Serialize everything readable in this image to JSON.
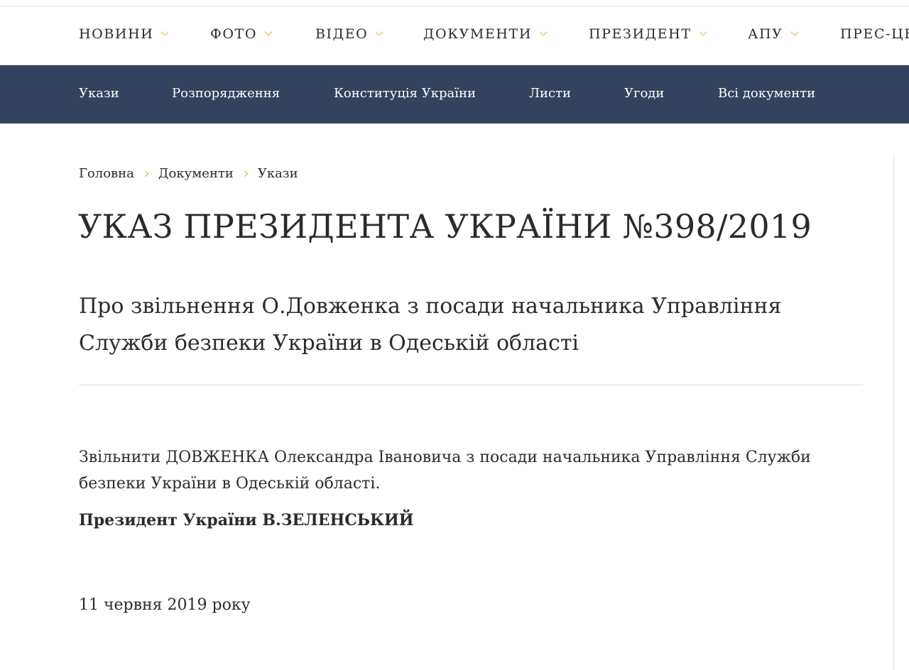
{
  "main_nav": {
    "items": [
      {
        "label": "НОВИНИ"
      },
      {
        "label": "ФОТО"
      },
      {
        "label": "ВІДЕО"
      },
      {
        "label": "ДОКУМЕНТИ"
      },
      {
        "label": "ПРЕЗИДЕНТ"
      },
      {
        "label": "АПУ"
      },
      {
        "label": "ПРЕС-ЦЕ"
      }
    ]
  },
  "sub_nav": {
    "items": [
      {
        "label": "Укази"
      },
      {
        "label": "Розпорядження"
      },
      {
        "label": "Конституція України"
      },
      {
        "label": "Листи"
      },
      {
        "label": "Угоди"
      },
      {
        "label": "Всі документи"
      }
    ]
  },
  "breadcrumb": {
    "items": [
      {
        "label": "Головна"
      },
      {
        "label": "Документи"
      },
      {
        "label": "Укази"
      }
    ]
  },
  "document": {
    "title": "УКАЗ ПРЕЗИДЕНТА УКРАЇНИ №398/2019",
    "subtitle": "Про звільнення О.Довженка з посади начальника Управління Служби безпеки України в Одеській області",
    "body": "Звільнити ДОВЖЕНКА Олександра Івановича з посади начальника Управління Служби безпеки України в Одеській області.",
    "signature": "Президент України В.ЗЕЛЕНСЬКИЙ",
    "date": "11 червня 2019 року"
  },
  "colors": {
    "accent": "#e8b52c",
    "subnav_bg": "#33425e",
    "text": "#2b2b2b"
  }
}
